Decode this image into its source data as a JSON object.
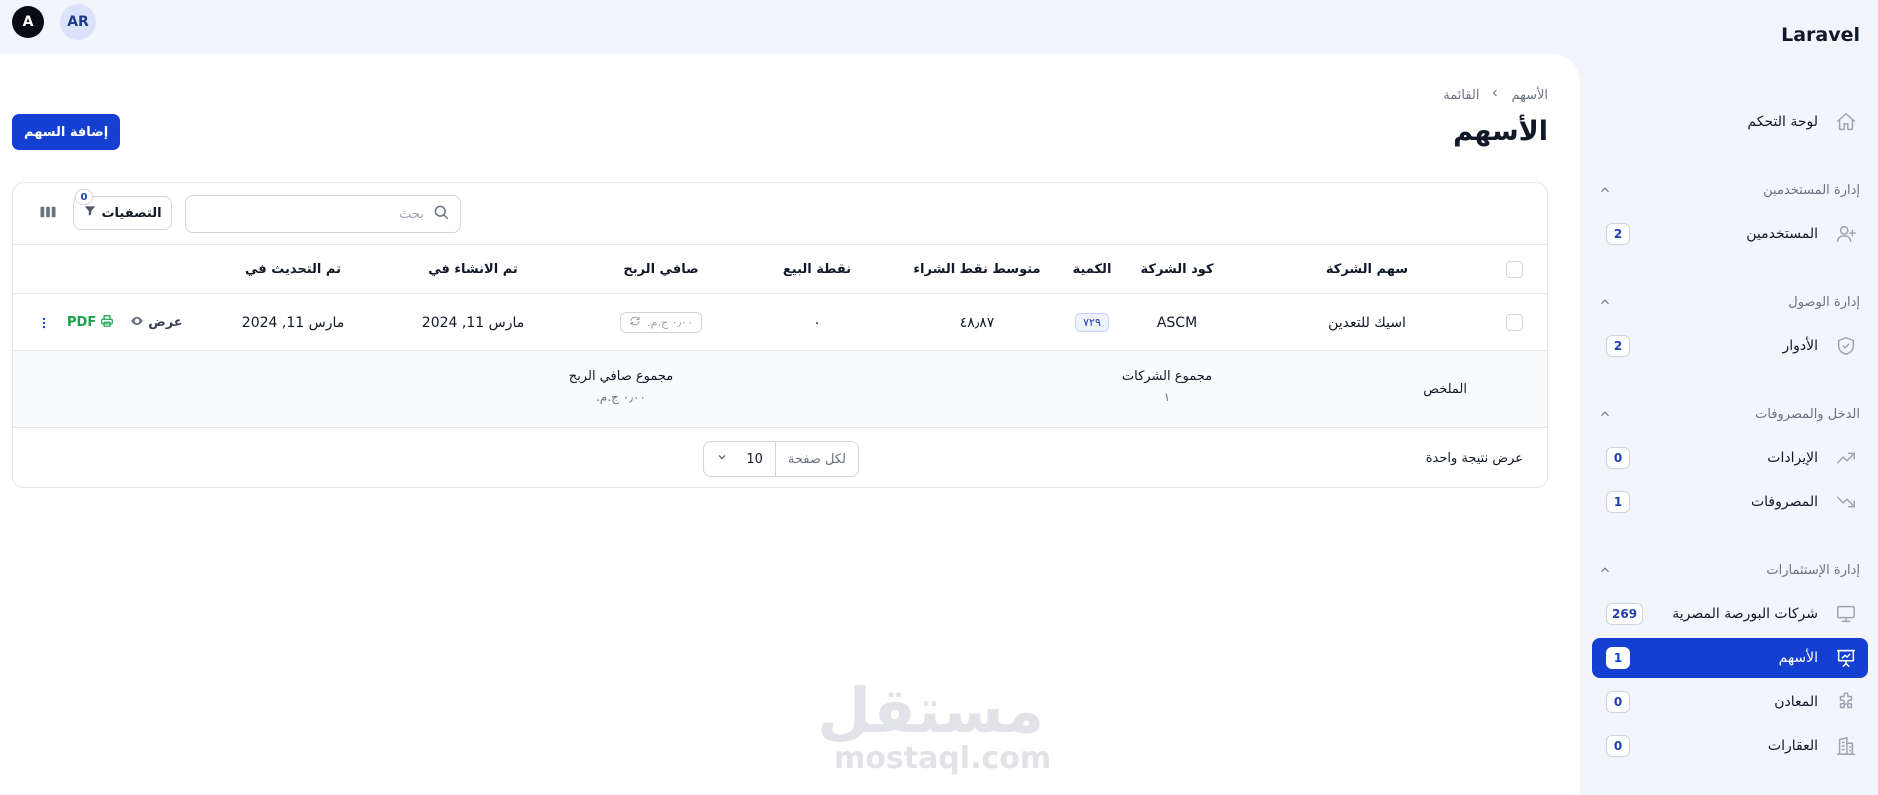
{
  "brand": "Laravel",
  "user": {
    "avatar_initial": "A",
    "locale_badge": "AR"
  },
  "sidebar": {
    "dashboard": {
      "label": "لوحة التحكم",
      "icon": "home-icon"
    },
    "groups": [
      {
        "title": "إدارة المستخدمين",
        "items": [
          {
            "label": "المستخدمين",
            "count": "2",
            "icon": "user-plus-icon"
          }
        ]
      },
      {
        "title": "إدارة الوصول",
        "items": [
          {
            "label": "الأدوار",
            "count": "2",
            "icon": "shield-check-icon"
          }
        ]
      },
      {
        "title": "الدخل والمصروفات",
        "items": [
          {
            "label": "الإيرادات",
            "count": "0",
            "icon": "trending-up-icon"
          },
          {
            "label": "المصروفات",
            "count": "1",
            "icon": "trending-down-icon"
          }
        ]
      },
      {
        "title": "إدارة الإستثمارات",
        "items": [
          {
            "label": "شركات البورصة المصرية",
            "count": "269",
            "icon": "computer-desktop-icon"
          },
          {
            "label": "الأسهم",
            "count": "1",
            "icon": "presentation-chart-icon",
            "active": true
          },
          {
            "label": "المعادن",
            "count": "0",
            "icon": "puzzle-icon"
          },
          {
            "label": "العقارات",
            "count": "0",
            "icon": "building-icon"
          }
        ]
      }
    ]
  },
  "breadcrumb": {
    "root": "الأسهم",
    "current": "القائمة"
  },
  "page": {
    "title": "الأسهم",
    "add_button": "إضافة السهم"
  },
  "toolbar": {
    "search_placeholder": "بحث",
    "filters_label": "التصفيات",
    "filters_count": "0"
  },
  "table": {
    "headers": {
      "company_stock": "سهم الشركة",
      "company_code": "كود الشركة",
      "quantity": "الكمية",
      "avg_buy_points": "متوسط نقط الشراء",
      "sell_point": "نقطة البيع",
      "net_profit": "صافي الربح",
      "created_at": "تم الانشاء في",
      "updated_at": "تم التحديث في"
    },
    "rows": [
      {
        "company_stock": "اسيك للتعدين",
        "company_code": "ASCM",
        "quantity": "٧٢٩",
        "avg_buy_points": "٤٨٫٨٧",
        "sell_point": "٠",
        "net_profit": "٠٫٠٠ ج.م.",
        "created_at": "مارس 11, 2024",
        "updated_at": "مارس 11, 2024",
        "actions": {
          "view": "عرض",
          "pdf": "PDF"
        }
      }
    ]
  },
  "summary": {
    "label": "الملخص",
    "companies_total_title": "مجموع الشركات",
    "companies_total_value": "١",
    "net_profit_total_title": "مجموع صافي الربح",
    "net_profit_total_value": "٠٫٠٠ ج.م."
  },
  "pagination": {
    "result_text": "عرض نتيجة واحدة",
    "per_page_label": "لكل صفحة",
    "per_page_value": "10"
  },
  "watermark": {
    "arabic": "مستقل",
    "latin": "mostaql.com"
  },
  "colors": {
    "primary": "#1340d0",
    "sidebar_bg": "#f3f5fc",
    "pdf_green": "#16a34a"
  }
}
